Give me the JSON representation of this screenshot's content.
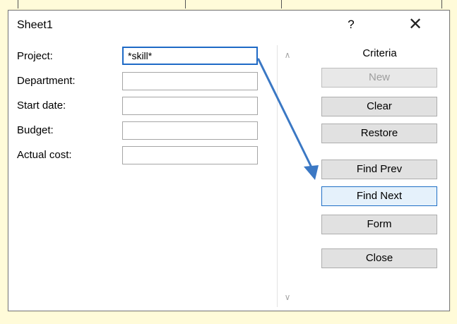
{
  "window": {
    "title": "Sheet1"
  },
  "title_buttons": {
    "help": "?",
    "close": "✕"
  },
  "fields": [
    {
      "label": "Project:",
      "value": "*skill*"
    },
    {
      "label": "Department:",
      "value": ""
    },
    {
      "label": "Start date:",
      "value": ""
    },
    {
      "label": "Budget:",
      "value": ""
    },
    {
      "label": "Actual cost:",
      "value": ""
    }
  ],
  "scroll": {
    "up": "∧",
    "down": "∨"
  },
  "criteria_label": "Criteria",
  "buttons": {
    "new": "New",
    "clear": "Clear",
    "restore": "Restore",
    "find_prev": "Find Prev",
    "find_next": "Find Next",
    "form": "Form",
    "close": "Close"
  },
  "colors": {
    "page_background": "#fffbd9",
    "annotation_arrow": "#3b78c4",
    "focus_border": "#1e6ac6"
  },
  "annotation": {
    "icon": "arrow-icon",
    "from": "project-input",
    "to": "find-next-button"
  }
}
